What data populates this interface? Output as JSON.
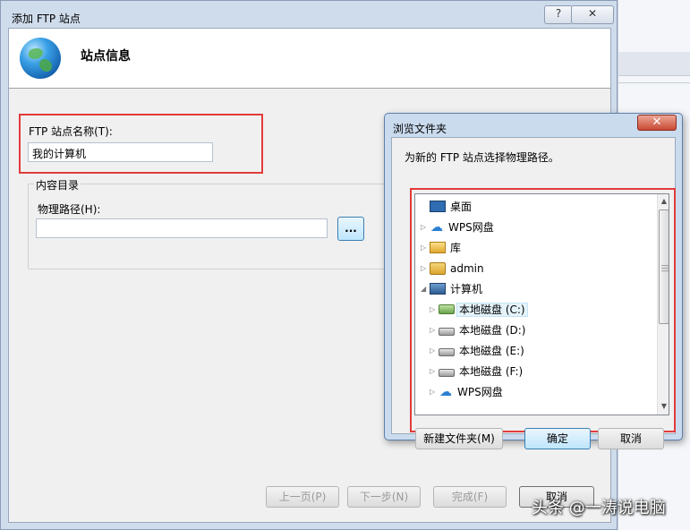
{
  "main_window": {
    "title": "添加 FTP 站点",
    "help_glyph": "?",
    "close_glyph": "✕",
    "header_title": "站点信息",
    "site_name_label": "FTP 站点名称(T):",
    "site_name_value": "我的计算机",
    "content_dir_label": "内容目录",
    "physical_path_label": "物理路径(H):",
    "physical_path_value": "",
    "browse_label": "...",
    "buttons": {
      "prev": "上一页(P)",
      "next": "下一步(N)",
      "finish": "完成(F)",
      "cancel": "取消"
    }
  },
  "browse_dialog": {
    "title": "浏览文件夹",
    "close_glyph": "✕",
    "description": "为新的 FTP 站点选择物理路径。",
    "tree": [
      {
        "label": "桌面",
        "icon": "desktop-icon",
        "level": 0,
        "expander": ""
      },
      {
        "label": "WPS网盘",
        "icon": "cloud-icon",
        "level": 0,
        "expander": "collapsed"
      },
      {
        "label": "库",
        "icon": "library-icon",
        "level": 0,
        "expander": "collapsed"
      },
      {
        "label": "admin",
        "icon": "user-folder-icon",
        "level": 0,
        "expander": "collapsed"
      },
      {
        "label": "计算机",
        "icon": "computer-icon",
        "level": 0,
        "expander": "expanded"
      },
      {
        "label": "本地磁盘 (C:)",
        "icon": "system-drive-icon",
        "level": 1,
        "expander": "collapsed",
        "selected": true
      },
      {
        "label": "本地磁盘 (D:)",
        "icon": "drive-icon",
        "level": 1,
        "expander": "collapsed"
      },
      {
        "label": "本地磁盘 (E:)",
        "icon": "drive-icon",
        "level": 1,
        "expander": "collapsed"
      },
      {
        "label": "本地磁盘 (F:)",
        "icon": "drive-icon",
        "level": 1,
        "expander": "collapsed"
      },
      {
        "label": "WPS网盘",
        "icon": "cloud-icon",
        "level": 1,
        "expander": "collapsed"
      }
    ],
    "buttons": {
      "new_folder": "新建文件夹(M)",
      "ok": "确定",
      "cancel": "取消"
    }
  },
  "watermark": "头条 @一涛说电脑",
  "colors": {
    "highlight_red": "#e23b3b",
    "dialog_frame": "#cadbee",
    "window_frame": "#cfdcec"
  }
}
